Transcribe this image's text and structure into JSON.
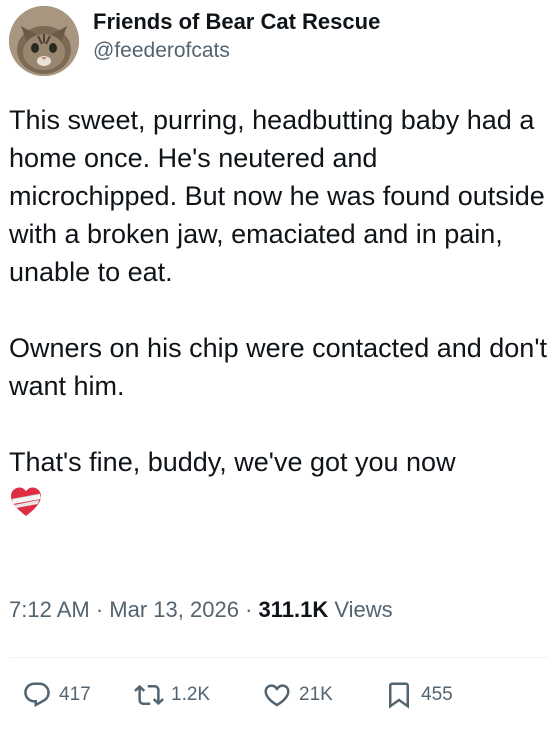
{
  "author": {
    "display_name": "Friends of Bear Cat Rescue",
    "handle": "@feederofcats",
    "avatar_icon": "cat-photo-avatar"
  },
  "post": {
    "paragraph_1": "This sweet, purring, headbutting baby had a home once. He's neutered and microchipped. But now he was found outside with a broken jaw, emaciated and in pain, unable to eat.",
    "paragraph_2": "Owners on his chip were contacted and don't want him.",
    "paragraph_3": "That's fine, buddy, we've got you now",
    "emoji_icon": "mending-heart-emoji"
  },
  "meta": {
    "time": "7:12 AM",
    "separator": "·",
    "date": "Mar 13, 2026",
    "views_count": "311.1K",
    "views_label": "Views"
  },
  "actions": {
    "replies": "417",
    "reposts": "1.2K",
    "likes": "21K",
    "bookmarks": "455"
  },
  "colors": {
    "text_primary": "#0f1419",
    "text_secondary": "#536471",
    "divider": "#eff3f4",
    "emoji_red": "#dd2e44"
  }
}
